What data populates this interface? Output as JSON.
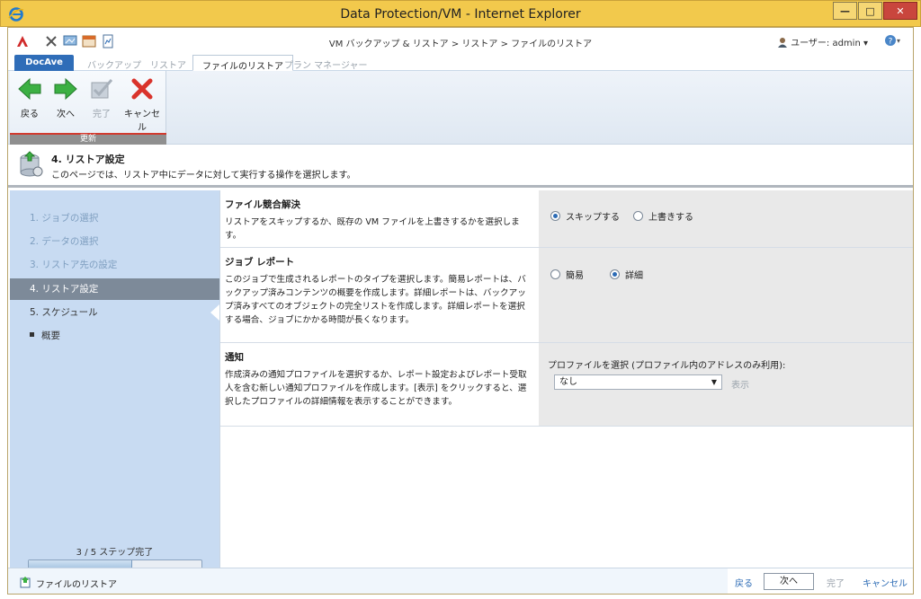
{
  "window": {
    "title": "Data Protection/VM - Internet Explorer",
    "controls": {
      "minimize": "—",
      "maximize": "□",
      "close": "✕"
    }
  },
  "toolbar": {
    "breadcrumb": "VM バックアップ & リストア > リストア > ファイルのリストア",
    "user_label": "ユーザー: admin ▾",
    "help_label": "▾"
  },
  "tabs": [
    {
      "label": "DocAve"
    },
    {
      "label": "バックアップ"
    },
    {
      "label": "リストア"
    },
    {
      "label": "ファイルのリストア"
    },
    {
      "label": "プラン マネージャー"
    }
  ],
  "ribbon": {
    "back_label": "戻る",
    "next_label": "次へ",
    "finish_label": "完了",
    "cancel_label": "キャンセル",
    "group_label": "更新"
  },
  "page": {
    "title": "4. リストア設定",
    "description": "このページでは、リストア中にデータに対して実行する操作を選択します。"
  },
  "steps": {
    "items": [
      {
        "label": "1. ジョブの選択"
      },
      {
        "label": "2. データの選択"
      },
      {
        "label": "3. リストア先の設定"
      },
      {
        "label": "4. リストア設定"
      },
      {
        "label": "5. スケジュール"
      },
      {
        "label": "概要"
      }
    ],
    "progress_text": "3 / 5 ステップ完了",
    "progress_fraction": 0.6
  },
  "sections": {
    "conflict": {
      "title": "ファイル競合解決",
      "description": "リストアをスキップするか、既存の VM ファイルを上書きするかを選択します。",
      "option_skip": "スキップする",
      "option_overwrite": "上書きする"
    },
    "report": {
      "title": "ジョブ レポート",
      "description": "このジョブで生成されるレポートのタイプを選択します。簡易レポートは、バックアップ済みコンテンツの概要を作成します。詳細レポートは、バックアップ済みすべてのオブジェクトの完全リストを作成します。詳細レポートを選択する場合、ジョブにかかる時間が長くなります。",
      "option_simple": "簡易",
      "option_detailed": "詳細"
    },
    "notification": {
      "title": "通知",
      "description": "作成済みの通知プロファイルを選択するか、レポート設定およびレポート受取人を含む新しい通知プロファイルを作成します。[表示] をクリックすると、選択したプロファイルの詳細情報を表示することができます。",
      "profile_label": "プロファイルを選択 (プロファイル内のアドレスのみ利用):",
      "profile_value": "なし",
      "view_label": "表示"
    }
  },
  "footer": {
    "label": "ファイルのリストア",
    "back": "戻る",
    "next": "次へ",
    "finish": "完了",
    "cancel": "キャンセル"
  }
}
